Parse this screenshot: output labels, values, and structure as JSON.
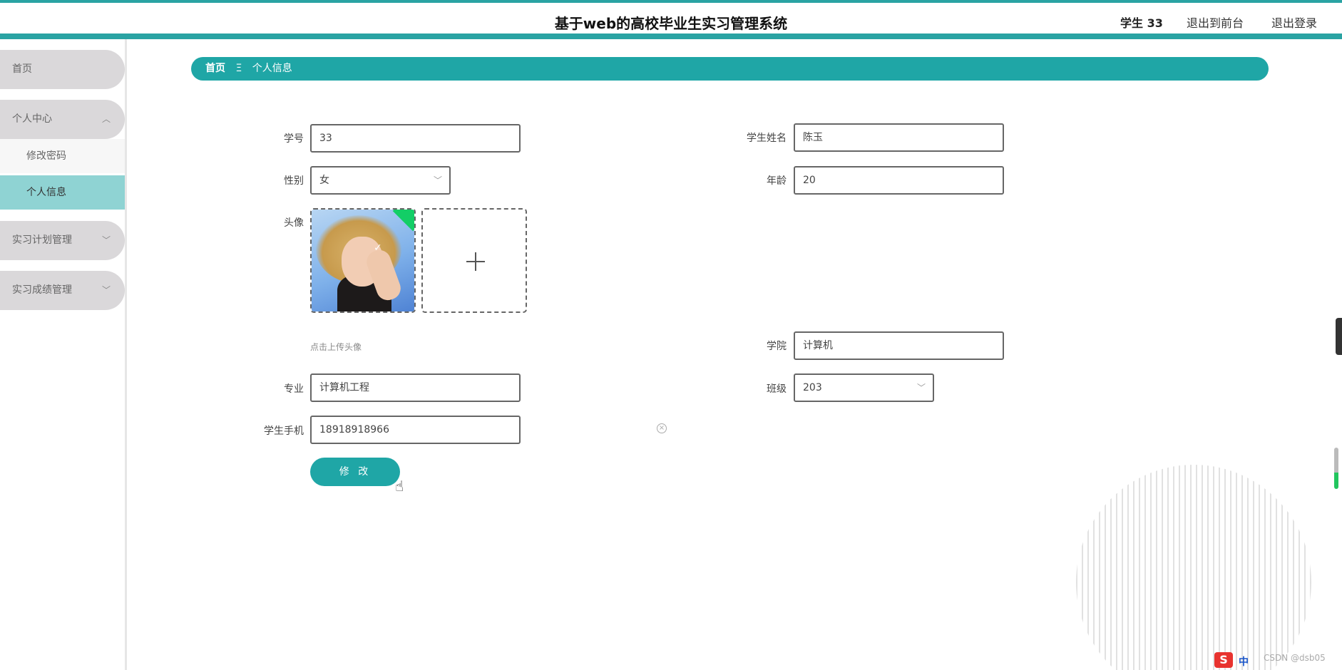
{
  "header": {
    "title": "基于web的高校毕业生实习管理系统",
    "user": "学生 33",
    "front_link": "退出到前台",
    "logout_link": "退出登录"
  },
  "sidebar": {
    "home": "首页",
    "personal_center": "个人中心",
    "change_password": "修改密码",
    "personal_info": "个人信息",
    "internship_plan": "实习计划管理",
    "internship_score": "实习成绩管理"
  },
  "breadcrumb": {
    "home": "首页",
    "separator": "Ξ",
    "current": "个人信息"
  },
  "form": {
    "student_id_label": "学号",
    "student_id_value": "33",
    "name_label": "学生姓名",
    "name_value": "陈玉",
    "gender_label": "性别",
    "gender_value": "女",
    "age_label": "年龄",
    "age_value": "20",
    "avatar_label": "头像",
    "upload_tip": "点击上传头像",
    "college_label": "学院",
    "college_value": "计算机",
    "major_label": "专业",
    "major_value": "计算机工程",
    "class_label": "班级",
    "class_value": "203",
    "phone_label": "学生手机",
    "phone_value": "18918918966",
    "submit_label": "修 改"
  },
  "overlay": {
    "watermark": "CSDN @dsb05",
    "ime_logo": "S",
    "ime_lang": "中"
  },
  "colors": {
    "accent": "#1fa6a6",
    "sidebar_active": "#8fd3d3",
    "sidebar_pill": "#dad8da"
  }
}
